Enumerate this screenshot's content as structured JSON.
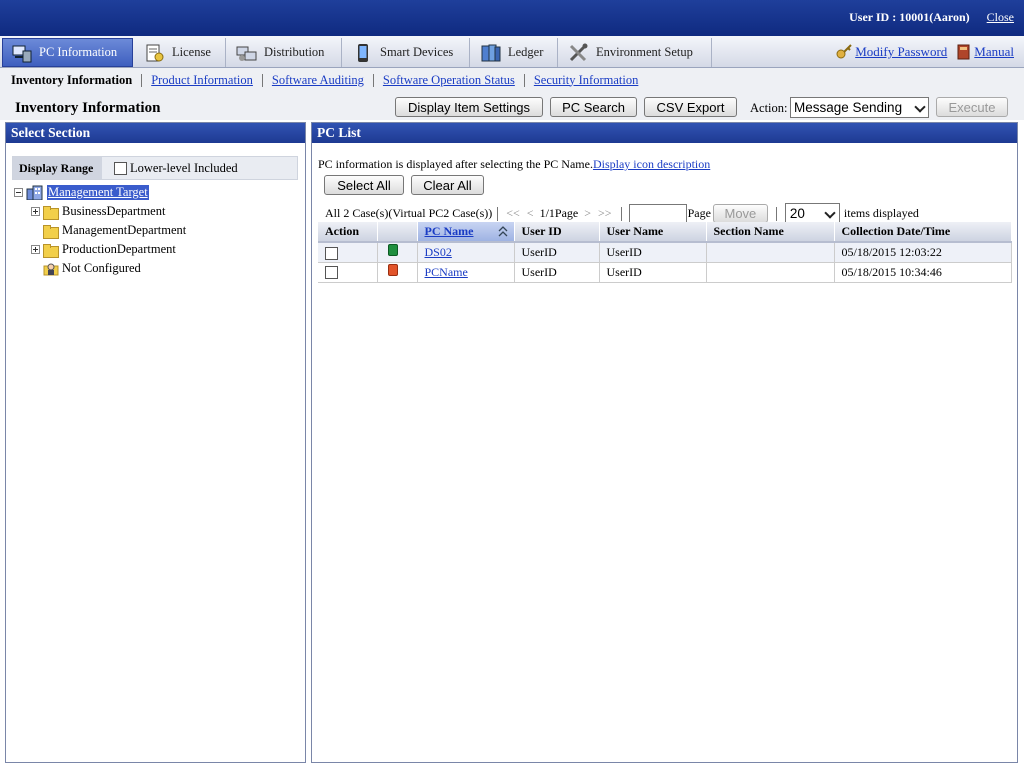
{
  "topbar": {
    "user_label": "User ID : 10001(Aaron)",
    "close": "Close"
  },
  "tabs": [
    {
      "label": "PC Information",
      "icon": "pc-info-icon",
      "active": true
    },
    {
      "label": "License",
      "icon": "license-icon"
    },
    {
      "label": "Distribution",
      "icon": "distribution-icon"
    },
    {
      "label": "Smart Devices",
      "icon": "smart-device-icon"
    },
    {
      "label": "Ledger",
      "icon": "ledger-icon"
    },
    {
      "label": "Environment Setup",
      "icon": "tools-icon"
    }
  ],
  "toplinks": {
    "modify_password": "Modify Password",
    "manual": "Manual"
  },
  "subnav": [
    "Inventory Information",
    "Product Information",
    "Software Auditing",
    "Software Operation Status",
    "Security Information"
  ],
  "page": {
    "title": "Inventory Information",
    "display_item_settings": "Display Item Settings",
    "pc_search": "PC Search",
    "csv_export": "CSV Export",
    "action_label": "Action:",
    "action_value": "Message Sending",
    "execute": "Execute"
  },
  "left": {
    "title": "Select Section",
    "display_range": "Display Range",
    "lower_level": "Lower-level Included",
    "tree": {
      "root": "Management Target",
      "children": [
        "BusinessDepartment",
        "ManagementDepartment",
        "ProductionDepartment",
        "Not Configured"
      ]
    }
  },
  "right": {
    "title": "PC List",
    "info": "PC information is displayed after selecting the PC Name.",
    "icon_desc": "Display icon description",
    "select_all": "Select All",
    "clear_all": "Clear All",
    "count": "All 2 Case(s)(Virtual PC2 Case(s))",
    "pager": {
      "first": "<<",
      "prev": "<",
      "status": "1/1Page",
      "next": ">",
      "last": ">>",
      "page_label": "Page",
      "page_value": "",
      "move": "Move",
      "per_page": "20",
      "items_displayed": "items displayed"
    },
    "columns": [
      "Action",
      "",
      "PC Name",
      "User ID",
      "User Name",
      "Section Name",
      "Collection Date/Time"
    ],
    "rows": [
      {
        "icon": "green",
        "pc_name": "DS02",
        "user_id": "UserID",
        "user_name": "UserID",
        "section": "",
        "date": "05/18/2015 12:03:22"
      },
      {
        "icon": "red",
        "pc_name": "PCName",
        "user_id": "UserID",
        "user_name": "UserID",
        "section": "",
        "date": "05/18/2015 10:34:46"
      }
    ]
  }
}
